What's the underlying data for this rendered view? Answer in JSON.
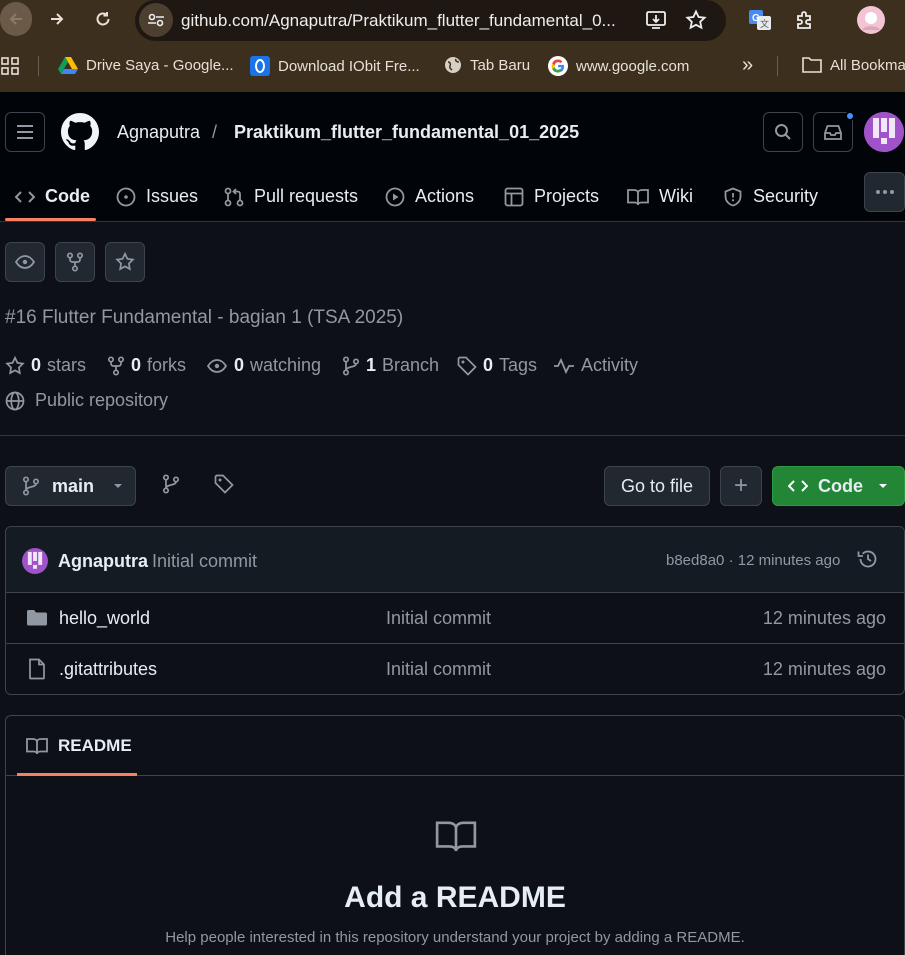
{
  "browser": {
    "url": "github.com/Agnaputra/Praktikum_flutter_fundamental_0...",
    "bookmarks": [
      {
        "label": "Drive Saya - Google...",
        "icon": "google-drive-icon"
      },
      {
        "label": "Download IObit Fre...",
        "icon": "iobit-icon"
      },
      {
        "label": "Tab Baru",
        "icon": "globe-icon"
      },
      {
        "label": "www.google.com",
        "icon": "google-icon"
      }
    ],
    "all_bookmarks": "All Bookmarks"
  },
  "header": {
    "owner": "Agnaputra",
    "separator": "/",
    "repo": "Praktikum_flutter_fundamental_01_2025"
  },
  "tabs": [
    {
      "label": "Code",
      "icon": "code-icon",
      "active": true
    },
    {
      "label": "Issues",
      "icon": "issue-icon"
    },
    {
      "label": "Pull requests",
      "icon": "pull-request-icon"
    },
    {
      "label": "Actions",
      "icon": "play-icon"
    },
    {
      "label": "Projects",
      "icon": "table-icon"
    },
    {
      "label": "Wiki",
      "icon": "book-icon"
    },
    {
      "label": "Security",
      "icon": "shield-icon"
    }
  ],
  "repo": {
    "description": "#16 Flutter Fundamental - bagian 1 (TSA 2025)",
    "stats": [
      {
        "count": "0",
        "label": "stars",
        "icon": "star-icon"
      },
      {
        "count": "0",
        "label": "forks",
        "icon": "fork-icon"
      },
      {
        "count": "0",
        "label": "watching",
        "icon": "eye-icon"
      },
      {
        "count": "1",
        "label": "Branch",
        "icon": "branch-icon"
      },
      {
        "count": "0",
        "label": "Tags",
        "icon": "tag-icon"
      },
      {
        "count": "",
        "label": "Activity",
        "icon": "pulse-icon"
      }
    ],
    "visibility": "Public repository"
  },
  "toolbar": {
    "branch": "main",
    "go_to_file": "Go to file",
    "add": "+",
    "code": "Code"
  },
  "latest_commit": {
    "author": "Agnaputra",
    "message": "Initial commit",
    "sha_time": "b8ed8a0 · 12 minutes ago"
  },
  "files": [
    {
      "name": "hello_world",
      "type": "folder",
      "message": "Initial commit",
      "time": "12 minutes ago"
    },
    {
      "name": ".gitattributes",
      "type": "file",
      "message": "Initial commit",
      "time": "12 minutes ago"
    }
  ],
  "readme": {
    "tab": "README",
    "title": "Add a README",
    "subtitle": "Help people interested in this repository understand your project by adding a README."
  },
  "colors": {
    "accent_underline": "#f78166",
    "code_button": "#238636",
    "background": "#0d1117",
    "notification_dot": "#4493f8"
  }
}
